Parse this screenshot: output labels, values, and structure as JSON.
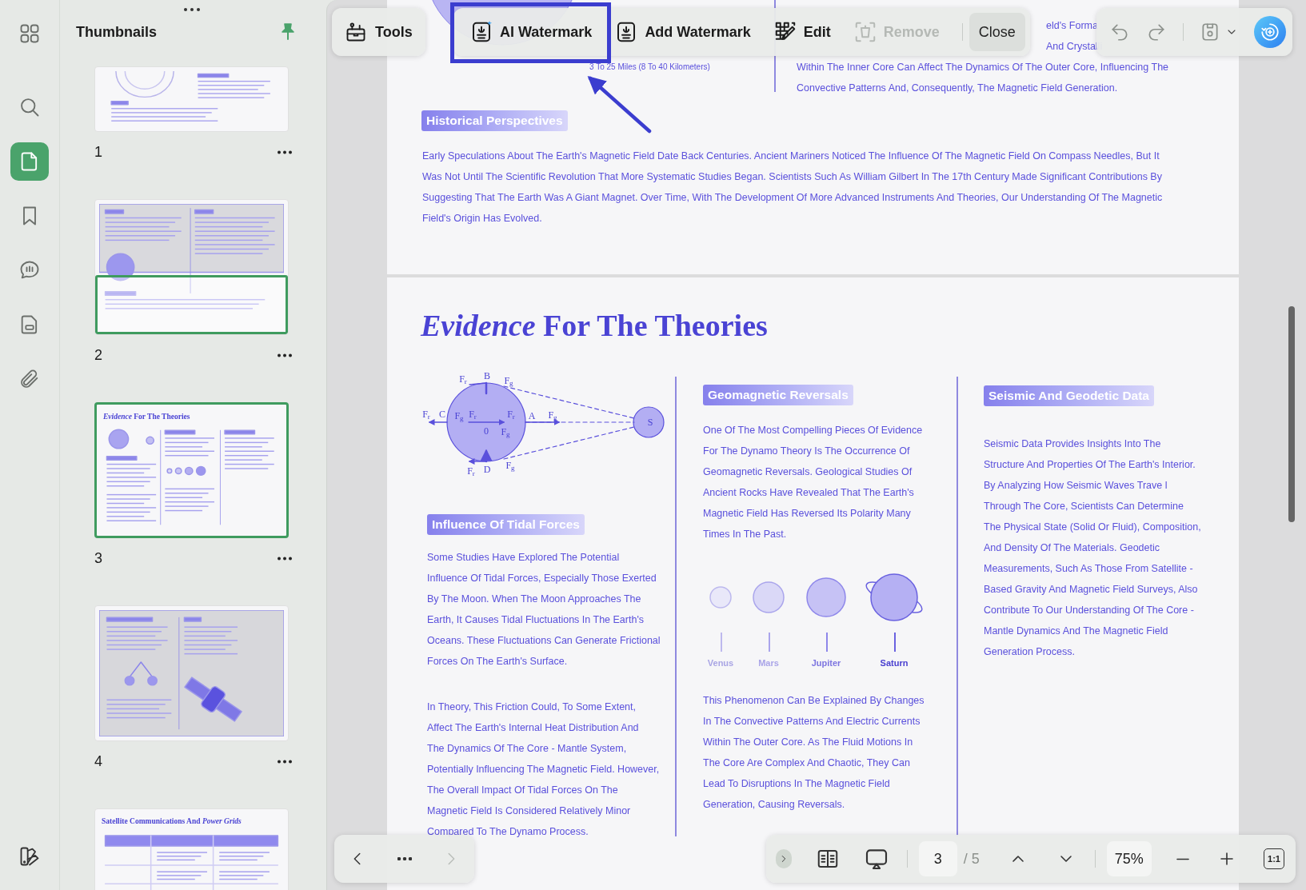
{
  "rail": [
    {
      "selected": false
    },
    {
      "selected": false
    },
    {
      "selected": true
    },
    {
      "selected": false
    },
    {
      "selected": false
    },
    {
      "selected": false
    },
    {
      "selected": false
    }
  ],
  "thumbnails": {
    "title": "Thumbnails",
    "pinned": true,
    "pages": [
      {
        "number": "1",
        "kind": "figure",
        "selected": false,
        "in_view": false
      },
      {
        "number": "2",
        "kind": "columns",
        "selected": false,
        "in_view": true
      },
      {
        "number": "3",
        "kind": "theories",
        "selected": true,
        "in_view": false,
        "title": "*Evidence* For The Theories"
      },
      {
        "number": "4",
        "kind": "satellite",
        "selected": false,
        "in_view": false
      },
      {
        "kind": "table",
        "selected": false,
        "in_view": false,
        "title": "Satellite Communications And *Power Grids*"
      }
    ]
  },
  "tools_button": {
    "label": "Tools"
  },
  "tools": [
    {
      "label": "AI Watermark",
      "kind": "ai",
      "highlighted": true,
      "disabled": false
    },
    {
      "label": "Add Watermark",
      "kind": "stamp",
      "highlighted": false,
      "disabled": false
    },
    {
      "label": "Edit",
      "kind": "edit",
      "highlighted": false,
      "disabled": false
    },
    {
      "label": "Remove",
      "kind": "remove",
      "highlighted": false,
      "disabled": true
    },
    {
      "label": "Close",
      "kind": "plain",
      "highlighted": false,
      "disabled": false
    }
  ],
  "page_top": {
    "caption": "3 To 25 Miles (8 To 40 Kilometers)",
    "right_fragments": [
      "eld's Forma",
      "And Crystalli"
    ],
    "right_lines": [
      "Within The Inner Core Can Affect The Dynamics Of The Outer Core, Influencing The",
      "Convective Patterns And, Consequently, The Magnetic Field Generation."
    ],
    "heading": "Historical Perspectives",
    "body": [
      "Early Speculations About The Earth's Magnetic Field Date Back Centuries. Ancient Mariners Noticed The Influence Of The Magnetic Field On Compass Needles, But It",
      "Was Not Until The Scientific Revolution That More Systematic Studies Began. Scientists Such As William Gilbert In The 17th Century Made Significant Contributions By",
      "Suggesting That The Earth Was A Giant Magnet. Over Time, With The Development Of More Advanced Instruments And Theories, Our Understanding Of The Magnetic",
      "Field's Origin Has Evolved."
    ]
  },
  "page": {
    "title": "*Evidence* For The Theories",
    "diagram_labels": [
      "F$_{r}$",
      "B",
      "F$_{g}$",
      "F$_{r}$",
      "C",
      "F$_{g}$",
      "F$_{r}$",
      "F$_{r}$",
      "A",
      "F$_{g}$",
      "S",
      "0",
      "F$_{g}$",
      "F$_{r}$",
      "D",
      "F$_{g}$"
    ],
    "tidal": {
      "heading": "Influence Of Tidal Forces",
      "paragraphs": [
        [
          "Some Studies Have Explored The Potential",
          "Influence Of Tidal Forces, Especially Those Exerted",
          "By The Moon. When The Moon Approaches The",
          "Earth, It Causes Tidal Fluctuations In The Earth's",
          "Oceans. These Fluctuations Can Generate Frictional",
          "Forces On The Earth's Surface."
        ],
        [
          "In Theory, This Friction Could, To Some Extent,",
          "Affect The Earth's Internal Heat Distribution And",
          "The Dynamics Of The Core - Mantle System,",
          "Potentially Influencing The Magnetic Field. However,",
          "The Overall Impact Of Tidal Forces On The",
          "Magnetic Field Is Considered Relatively Minor",
          "Compared To The Dynamo Process."
        ]
      ]
    },
    "reversals": {
      "heading": "Geomagnetic Reversals",
      "intro": [
        "One Of The Most Compelling Pieces Of Evidence",
        "For The Dynamo Theory Is The Occurrence Of",
        "Geomagnetic Reversals. Geological Studies Of",
        "Ancient Rocks Have Revealed That The Earth's",
        "Magnetic Field Has Reversed Its Polarity Many",
        "Times In The Past."
      ],
      "planets": [
        {
          "name": "Venus"
        },
        {
          "name": "Mars"
        },
        {
          "name": "Jupiter"
        },
        {
          "name": "Saturn"
        }
      ],
      "outro": [
        "This Phenomenon Can Be Explained By Changes",
        "In The Convective Patterns And Electric Currents",
        "Within The Outer Core. As The Fluid Motions In",
        "The Core Are Complex And Chaotic, They Can",
        "Lead To Disruptions In The Magnetic Field",
        "Generation, Causing Reversals."
      ]
    },
    "seismic": {
      "heading": "Seismic And Geodetic Data",
      "body": [
        "Seismic Data Provides Insights Into The",
        "Structure And Properties Of The Earth's Interior.",
        "By Analyzing How Seismic Waves Trave l",
        "Through The Core, Scientists Can Determine",
        "The Physical State (Solid Or Fluid), Composition,",
        "And Density Of The Materials. Geodetic",
        "Measurements, Such As Those From Satellite -",
        "Based Gravity And Magnetic Field Surveys, Also",
        "Contribute To Our Understanding Of The Core -",
        "Mantle Dynamics And The Magnetic Field",
        "Generation Process."
      ]
    }
  },
  "navigation": {
    "next_disabled": true
  },
  "page_controls": {
    "current_page": "3",
    "total": "/ 5",
    "zoom": "75%",
    "actual_size": "1:1"
  }
}
